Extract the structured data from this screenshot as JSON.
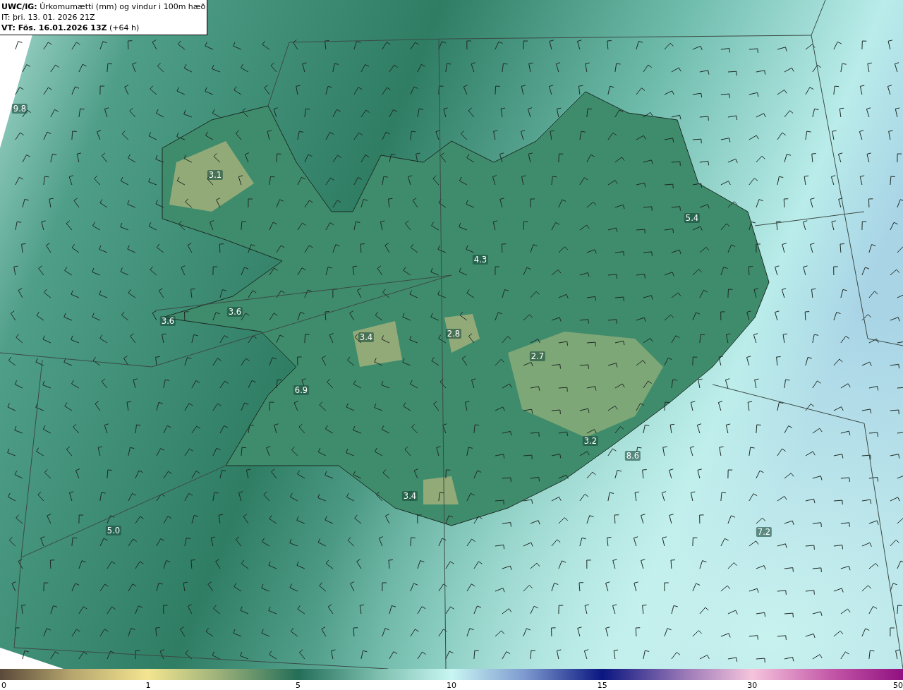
{
  "header": {
    "title": "**UWC/IG:** Úrkomumætti (mm) og vindur i 100m hæð",
    "issue_time": "IT: þri. 13. 01. 2026 21Z",
    "valid_time": "**VT: Fös. 16.01.2026 13Z** (+64 h)"
  },
  "map": {
    "value_labels": [
      "9.8",
      "3.1",
      "3.6",
      "3.6",
      "3.4",
      "2.8",
      "2.7",
      "6.9",
      "4.3",
      "5.4",
      "3.2",
      "8.6",
      "3.4",
      "5.0",
      "7.2"
    ]
  },
  "color_scale": {
    "ticks": [
      "0",
      "1",
      "5",
      "10",
      "15",
      "30",
      "50"
    ]
  }
}
